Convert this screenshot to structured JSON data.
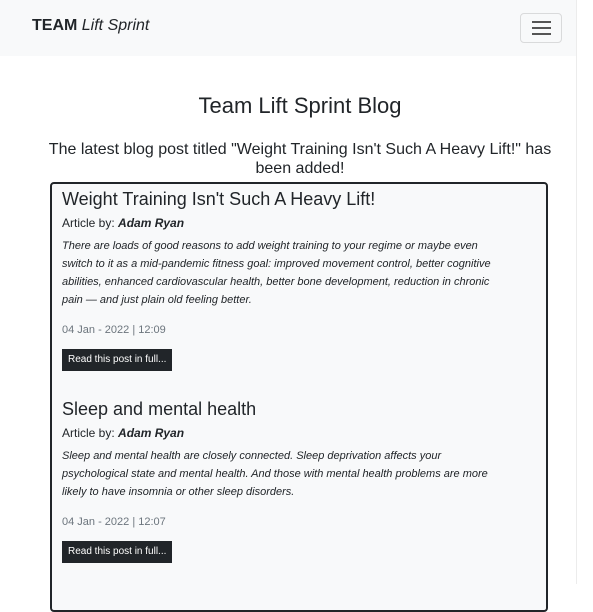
{
  "navbar": {
    "brand_strong": "TEAM",
    "brand_em": "Lift Sprint",
    "toggler_icon": "hamburger-menu-icon"
  },
  "page": {
    "title": "Team Lift Sprint Blog",
    "notice": "The latest blog post titled \"Weight Training Isn't Such A Heavy Lift!\" has been added!"
  },
  "posts": [
    {
      "title": "Weight Training Isn't Such A Heavy Lift!",
      "author_label": "Article by:",
      "author": "Adam Ryan",
      "excerpt": "There are loads of good reasons to add weight training to your regime or maybe even switch to it as a mid-pandemic fitness goal: improved movement control, better cognitive abilities, enhanced cardiovascular health, better bone development, reduction in chronic pain — and just plain old feeling better.",
      "date": "04 Jan - 2022 | 12:09",
      "button_label": "Read this post in full..."
    },
    {
      "title": "Sleep and mental health",
      "author_label": "Article by:",
      "author": "Adam Ryan",
      "excerpt": "Sleep and mental health are closely connected. Sleep deprivation affects your psychological state and mental health. And those with mental health problems are more likely to have insomnia or other sleep disorders.",
      "date": "04 Jan - 2022 | 12:07",
      "button_label": "Read this post in full..."
    }
  ],
  "colors": {
    "navbar_bg": "#f8f9fa",
    "text": "#212529",
    "button_bg": "#212529",
    "date_text": "#6c757d"
  }
}
